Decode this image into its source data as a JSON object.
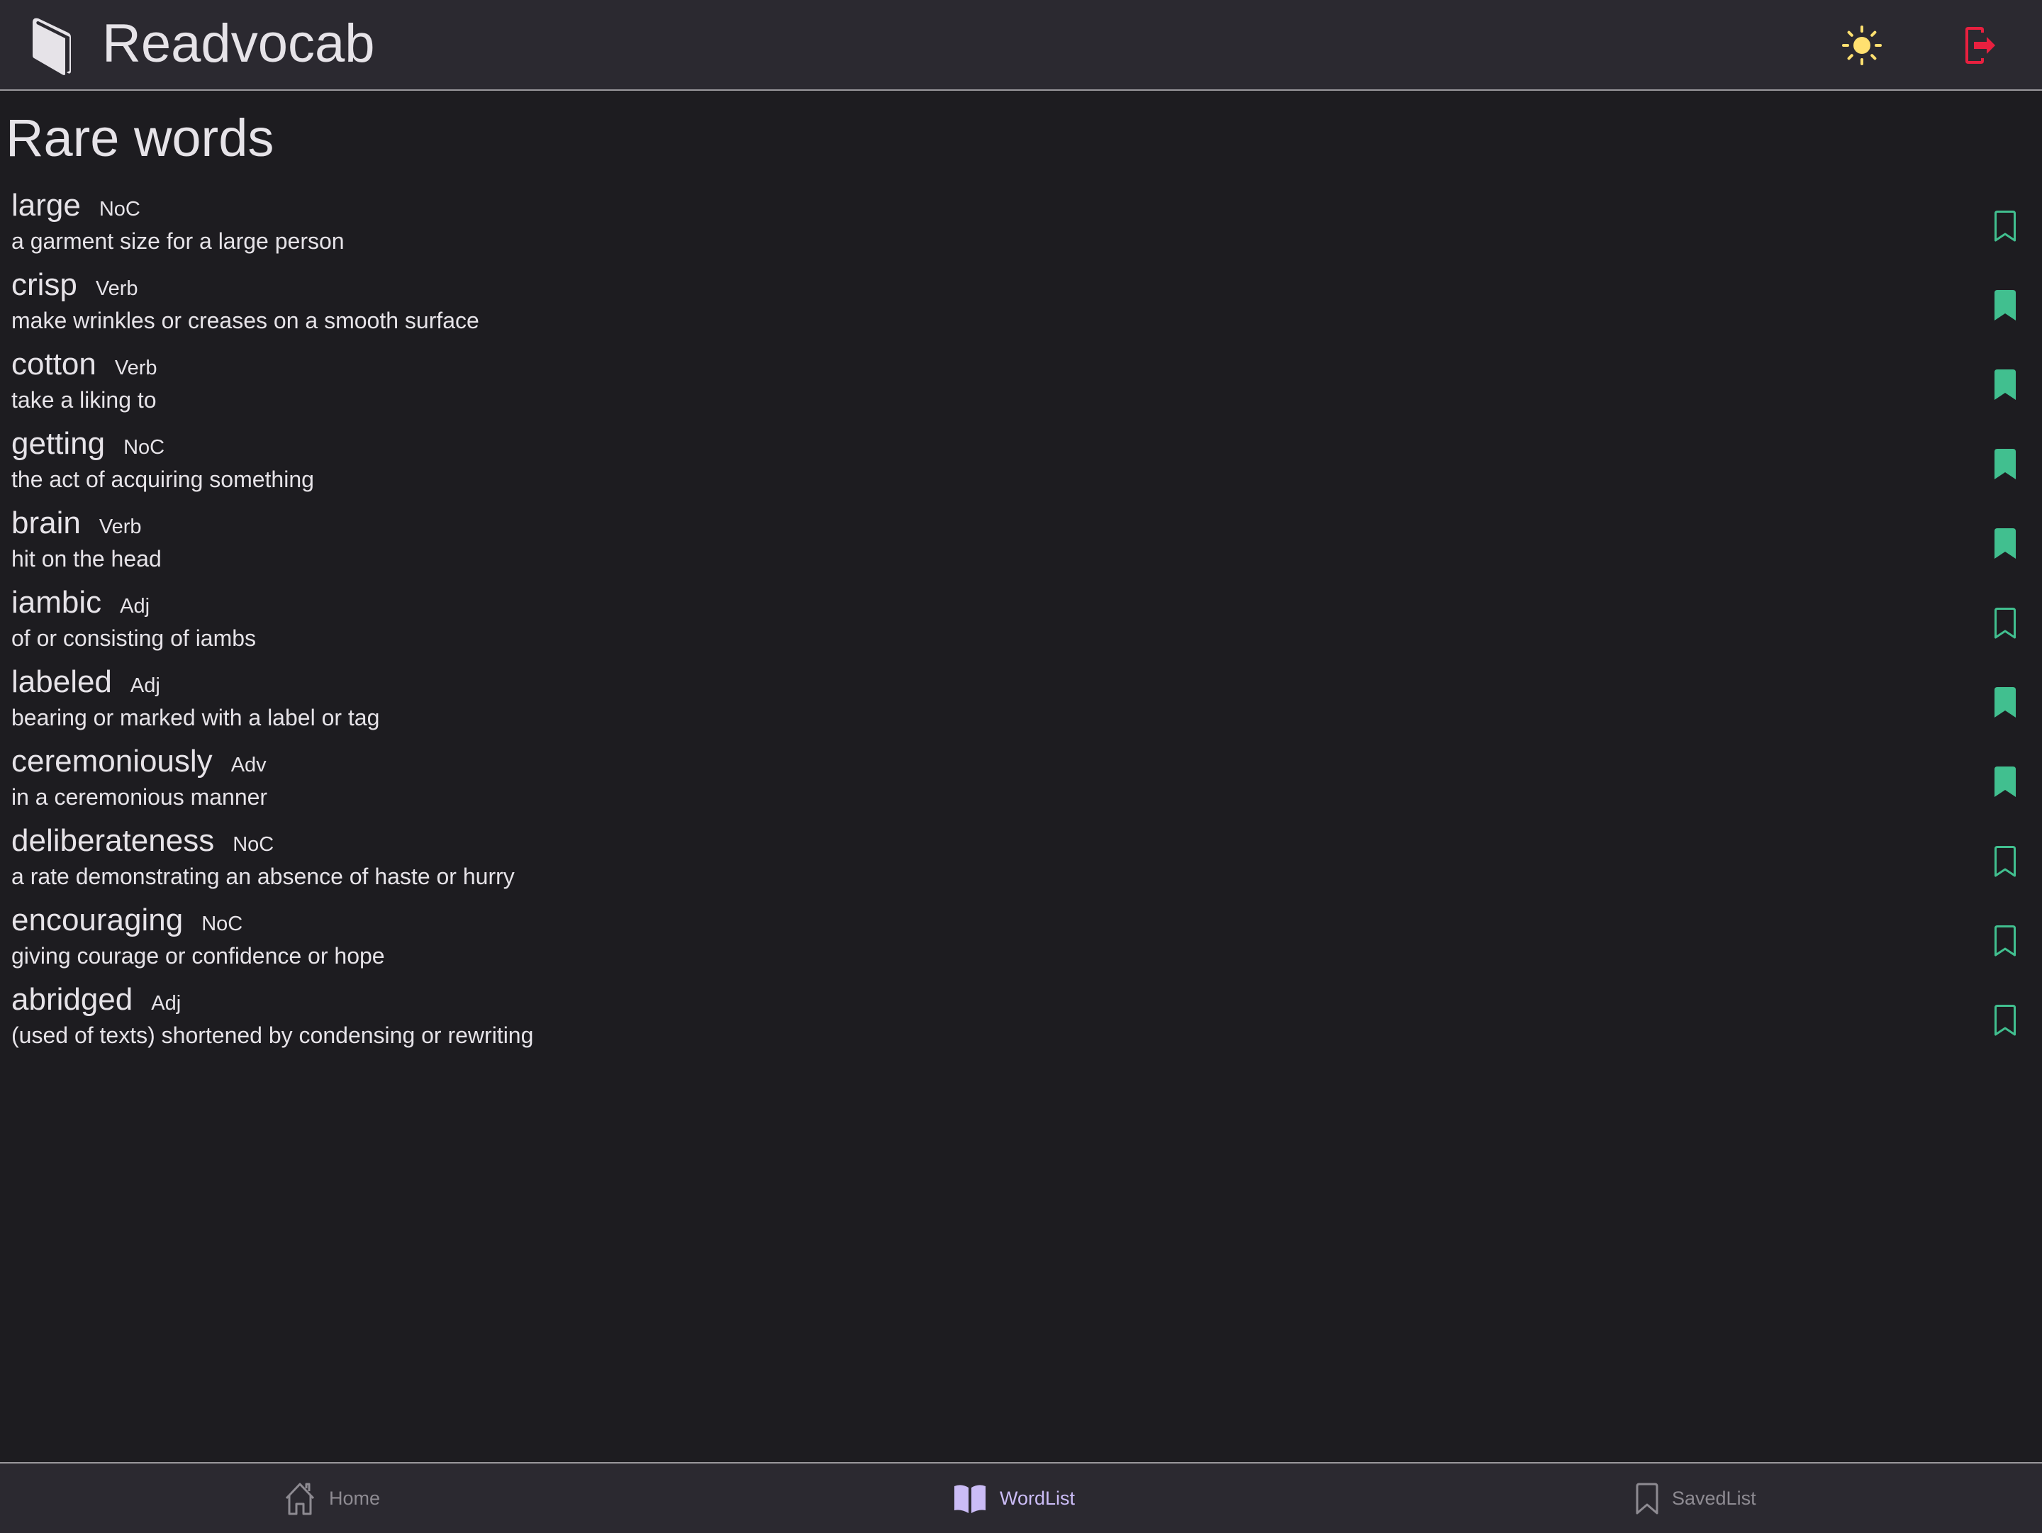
{
  "header": {
    "title": "Readvocab",
    "logo_icon": "book-icon",
    "theme_toggle_icon": "sun-icon",
    "logout_icon": "logout-icon"
  },
  "page": {
    "title": "Rare words"
  },
  "colors": {
    "accent": "#41bf8f",
    "sun": "#ffe070",
    "logout": "#e8203f",
    "nav_active": "#cbbcf6",
    "nav_inactive": "#8e8b92"
  },
  "words": [
    {
      "word": "large",
      "pos": "NoC",
      "definition": "a garment size for a large person",
      "saved": false
    },
    {
      "word": "crisp",
      "pos": "Verb",
      "definition": "make wrinkles or creases on a smooth surface",
      "saved": true
    },
    {
      "word": "cotton",
      "pos": "Verb",
      "definition": "take a liking to",
      "saved": true
    },
    {
      "word": "getting",
      "pos": "NoC",
      "definition": "the act of acquiring something",
      "saved": true
    },
    {
      "word": "brain",
      "pos": "Verb",
      "definition": "hit on the head",
      "saved": true
    },
    {
      "word": "iambic",
      "pos": "Adj",
      "definition": "of or consisting of iambs",
      "saved": false
    },
    {
      "word": "labeled",
      "pos": "Adj",
      "definition": "bearing or marked with a label or tag",
      "saved": true
    },
    {
      "word": "ceremoniously",
      "pos": "Adv",
      "definition": "in a ceremonious manner",
      "saved": true
    },
    {
      "word": "deliberateness",
      "pos": "NoC",
      "definition": "a rate demonstrating an absence of haste or hurry",
      "saved": false
    },
    {
      "word": "encouraging",
      "pos": "NoC",
      "definition": "giving courage or confidence or hope",
      "saved": false
    },
    {
      "word": "abridged",
      "pos": "Adj",
      "definition": "(used of texts) shortened by condensing or rewriting",
      "saved": false
    }
  ],
  "bottom_nav": [
    {
      "label": "Home",
      "icon": "home-icon",
      "active": false
    },
    {
      "label": "WordList",
      "icon": "open-book-icon",
      "active": true
    },
    {
      "label": "SavedList",
      "icon": "bookmark-icon",
      "active": false
    }
  ]
}
